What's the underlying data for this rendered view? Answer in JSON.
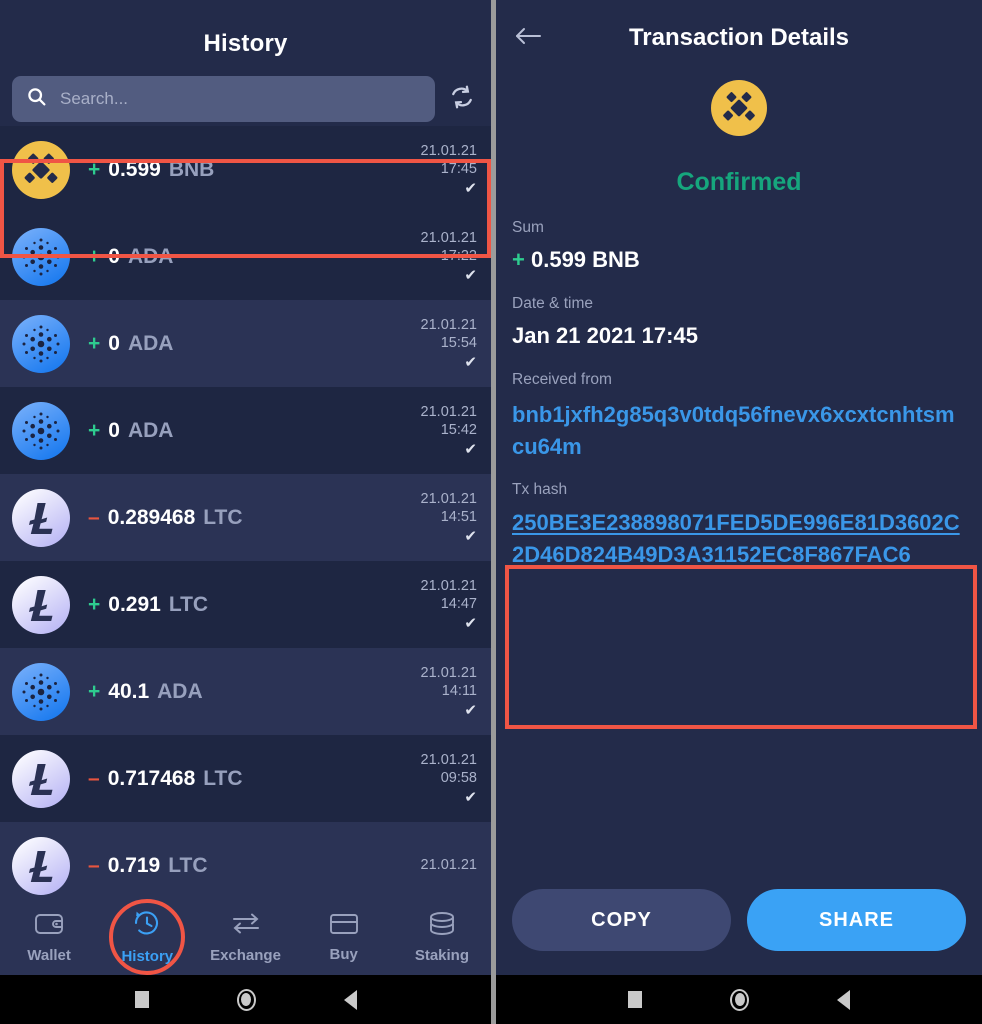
{
  "left": {
    "title": "History",
    "search": {
      "placeholder": "Search...",
      "value": ""
    },
    "refresh_icon": "refresh-icon",
    "transactions": [
      {
        "coin": "BNB",
        "icon": "bnb-coin-icon",
        "sign": "+",
        "amount": "0.599",
        "ticker": "BNB",
        "date": "21.01.21",
        "time": "17:45",
        "status_icon": "check-icon",
        "highlighted": true
      },
      {
        "coin": "ADA",
        "icon": "ada-coin-icon",
        "sign": "+",
        "amount": "0",
        "ticker": "ADA",
        "date": "21.01.21",
        "time": "17:22",
        "status_icon": "check-icon",
        "highlighted": false
      },
      {
        "coin": "ADA",
        "icon": "ada-coin-icon",
        "sign": "+",
        "amount": "0",
        "ticker": "ADA",
        "date": "21.01.21",
        "time": "15:54",
        "status_icon": "check-icon",
        "highlighted": false
      },
      {
        "coin": "ADA",
        "icon": "ada-coin-icon",
        "sign": "+",
        "amount": "0",
        "ticker": "ADA",
        "date": "21.01.21",
        "time": "15:42",
        "status_icon": "check-icon",
        "highlighted": false
      },
      {
        "coin": "LTC",
        "icon": "ltc-coin-icon",
        "sign": "–",
        "amount": "0.289468",
        "ticker": "LTC",
        "date": "21.01.21",
        "time": "14:51",
        "status_icon": "check-icon",
        "highlighted": false
      },
      {
        "coin": "LTC",
        "icon": "ltc-coin-icon",
        "sign": "+",
        "amount": "0.291",
        "ticker": "LTC",
        "date": "21.01.21",
        "time": "14:47",
        "status_icon": "check-icon",
        "highlighted": false
      },
      {
        "coin": "ADA",
        "icon": "ada-coin-icon",
        "sign": "+",
        "amount": "40.1",
        "ticker": "ADA",
        "date": "21.01.21",
        "time": "14:11",
        "status_icon": "check-icon",
        "highlighted": false
      },
      {
        "coin": "LTC",
        "icon": "ltc-coin-icon",
        "sign": "–",
        "amount": "0.717468",
        "ticker": "LTC",
        "date": "21.01.21",
        "time": "09:58",
        "status_icon": "check-icon",
        "highlighted": false
      },
      {
        "coin": "LTC",
        "icon": "ltc-coin-icon",
        "sign": "–",
        "amount": "0.719",
        "ticker": "LTC",
        "date": "21.01.21",
        "time": "",
        "status_icon": "check-icon",
        "highlighted": false
      }
    ],
    "nav": [
      {
        "label": "Wallet",
        "icon": "wallet-icon",
        "active": false
      },
      {
        "label": "History",
        "icon": "history-clock-icon",
        "active": true,
        "annotated": true
      },
      {
        "label": "Exchange",
        "icon": "exchange-arrows-icon",
        "active": false
      },
      {
        "label": "Buy",
        "icon": "credit-card-icon",
        "active": false
      },
      {
        "label": "Staking",
        "icon": "stack-coins-icon",
        "active": false
      }
    ]
  },
  "right": {
    "back_icon": "back-arrow-icon",
    "title": "Transaction Details",
    "coin_icon": "bnb-coin-icon",
    "status": "Confirmed",
    "fields": {
      "sum_label": "Sum",
      "sum_sign": "+",
      "sum_value": "0.599 BNB",
      "date_label": "Date & time",
      "date_value": "Jan 21 2021 17:45",
      "from_label": "Received from",
      "from_value": "bnb1jxfh2g85q3v0tdq56fnevx6xcxtcnhtsmcu64m",
      "hash_label": "Tx hash",
      "hash_value": "250BE3E238898071FED5DE996E81D3602C2D46D824B49D3A31152EC8F867FAC6"
    },
    "buttons": {
      "copy": "COPY",
      "share": "SHARE"
    }
  },
  "android_nav": {
    "recents": "square-recents-icon",
    "home": "circle-home-icon",
    "back": "triangle-back-icon"
  },
  "colors": {
    "accent_blue": "#3aa2f5",
    "positive_green": "#2ecc8f",
    "negative_red": "#e8553f",
    "status_green": "#16a67d",
    "annotation_red": "#f05545",
    "bnb_gold": "#f0c04a",
    "link_blue": "#3a97e8",
    "row_dark": "#1e2642",
    "row_light": "#2b3355",
    "panel_bg": "#232b4a"
  }
}
